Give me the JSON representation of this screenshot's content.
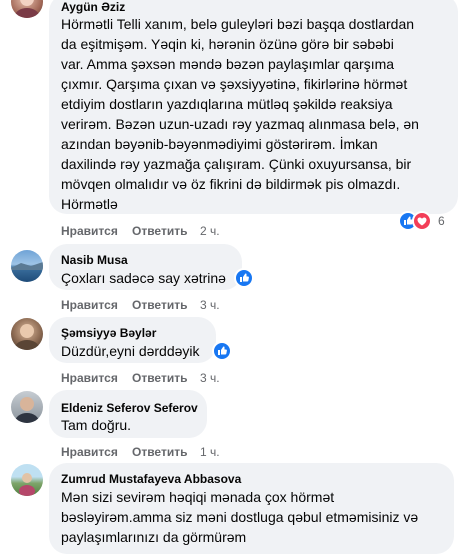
{
  "comments": [
    {
      "author": "Aygün Əziz",
      "text": "Hörmətli Telli xanım, belə guleyləri bəzi başqa dostlardan\nda eşitmişəm. Yəqin ki, hərənin özünə görə bir səbəbi\nvar. Amma şəxsən məndə bəzən paylaşımlar qarşıma\nçıxmır. Qarşıma çıxan və şəxsiyyətinə, fikirlərinə hörmət\netdiyim dostların yazdıqlarına mütləq şəkildə reaksiya\nverirəm. Bəzən uzun-uzadı rəy yazmaq alınmasa belə, ən\nazından bəyənib-bəyənmədiyimi göstərirəm. İmkan\ndaxilində rəy yazmağa çalışıram. Çünki oxuyursansa, bir\nmövqen olmalıdır və öz fikrini də bildirmək pis olmazdı.\nHörmətlə",
      "reaction_count": "6",
      "like_label": "Нравится",
      "reply_label": "Ответить",
      "time": "2 ч."
    },
    {
      "author": "Nasib Musa",
      "text": "Çoxları sadəcə say xətrinə",
      "like_label": "Нравится",
      "reply_label": "Ответить",
      "time": "3 ч."
    },
    {
      "author": "Şəmsiyyə Bəylər",
      "text": "Düzdür,eyni dərddəyik",
      "like_label": "Нравится",
      "reply_label": "Ответить",
      "time": "3 ч."
    },
    {
      "author": "Eldeniz Seferov Seferov",
      "text": "Tam doğru.",
      "like_label": "Нравится",
      "reply_label": "Ответить",
      "time": "1 ч."
    },
    {
      "author": "Zumrud Mustafayeva Abbasova",
      "text": "Mən sizi sevirəm həqiqi mənada çox hörmət\nbəsləyirəm.amma siz məni dostluga qəbul etməmisiniz və\npaylaşımlarınızı da görmürəm"
    }
  ],
  "colors": {
    "bubble": "#f0f2f5",
    "meta": "#65676b",
    "like_blue": "#1877f2",
    "love_red": "#f33e58"
  }
}
